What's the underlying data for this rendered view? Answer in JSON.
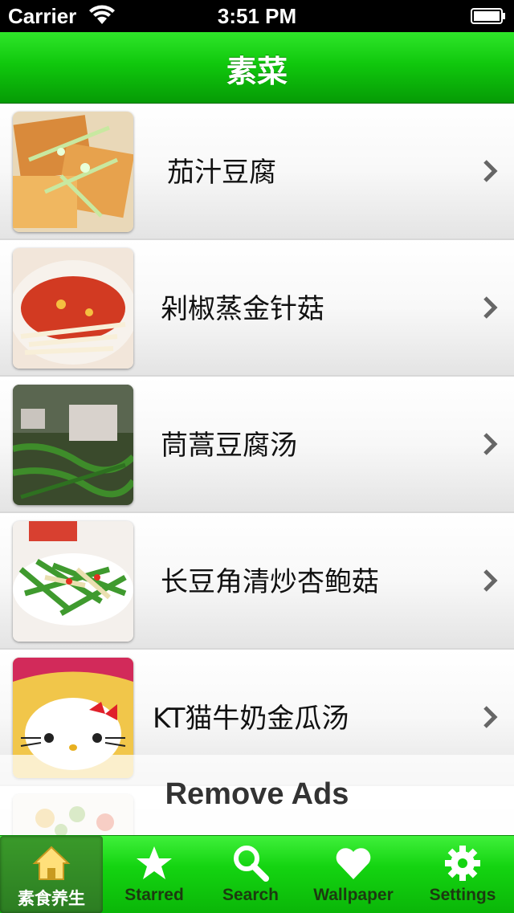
{
  "status_bar": {
    "carrier": "Carrier",
    "time": "3:51 PM"
  },
  "nav": {
    "title": "素菜"
  },
  "list": [
    {
      "label": "茄汁豆腐"
    },
    {
      "label": "剁椒蒸金针菇"
    },
    {
      "label": "茼蒿豆腐汤"
    },
    {
      "label": "长豆角清炒杏鲍菇"
    },
    {
      "label": "KT猫牛奶金瓜汤"
    }
  ],
  "ad": {
    "text": "Remove Ads"
  },
  "tabs": [
    {
      "label": "素食养生",
      "icon": "home-icon",
      "active": true
    },
    {
      "label": "Starred",
      "icon": "star-icon",
      "active": false
    },
    {
      "label": "Search",
      "icon": "search-icon",
      "active": false
    },
    {
      "label": "Wallpaper",
      "icon": "heart-icon",
      "active": false
    },
    {
      "label": "Settings",
      "icon": "gear-icon",
      "active": false
    }
  ],
  "colors": {
    "nav_green": "#10c80d",
    "tab_green": "#14d411",
    "active_tab": "#2c7d22"
  }
}
